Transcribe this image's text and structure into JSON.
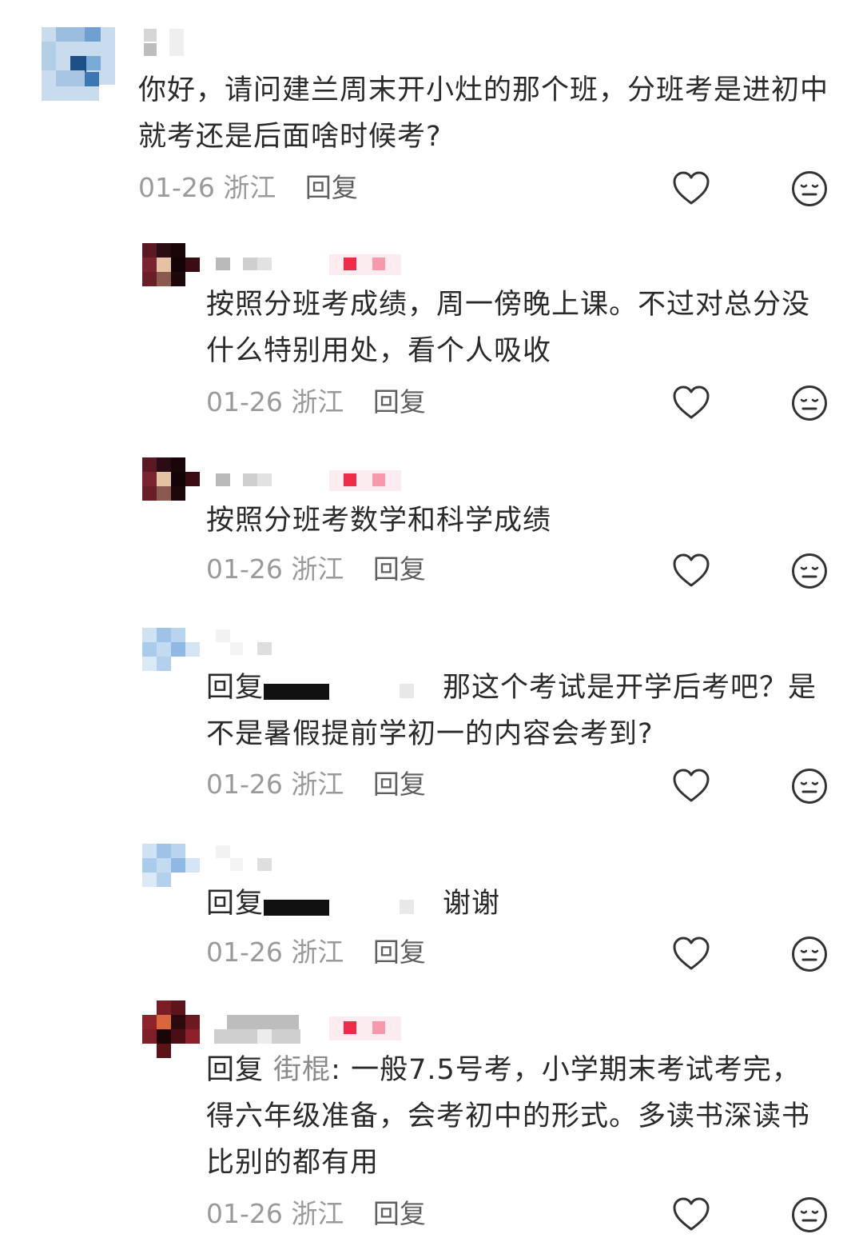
{
  "comments": [
    {
      "text": "你好，请问建兰周末开小灶的那个班，分班考是进初中就考还是后面啥时候考?",
      "date": "01-26",
      "location": "浙江",
      "reply_label": "回复",
      "like_icon": "heart-icon",
      "dislike_icon": "meh-face-icon"
    },
    {
      "text": "按照分班考成绩，周一傍晚上课。不过对总分没什么特别用处，看个人吸收",
      "date": "01-26",
      "location": "浙江",
      "reply_label": "回复"
    },
    {
      "text": "按照分班考数学和科学成绩",
      "date": "01-26",
      "location": "浙江",
      "reply_label": "回复"
    },
    {
      "prefix": "回复",
      "text": "那这个考试是开学后考吧？是不是暑假提前学初一的内容会考到?",
      "date": "01-26",
      "location": "浙江",
      "reply_label": "回复"
    },
    {
      "prefix": "回复",
      "text": "谢谢",
      "date": "01-26",
      "location": "浙江",
      "reply_label": "回复"
    },
    {
      "prefix": "回复",
      "mention": "街棍",
      "text": ": 一般7.5号考，小学期末考试考完，得六年级准备，会考初中的形式。多读书深读书比别的都有用",
      "date": "01-26",
      "location": "浙江",
      "reply_label": "回复"
    }
  ],
  "colors": {
    "text": "#2a2a2a",
    "meta": "#9a9a9a",
    "mention": "#8a8a8a",
    "badge_red": "#ee2c4a"
  }
}
